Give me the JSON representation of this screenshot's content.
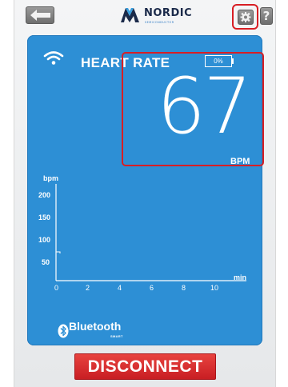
{
  "header": {
    "back_icon": "arrow-left-icon",
    "logo_text": "NORDIC",
    "logo_subtext": "SEMICONDUCTOR",
    "settings_icon": "gear-icon",
    "help_label": "?"
  },
  "panel": {
    "title": "HEART RATE",
    "status_icon": "wifi-icon",
    "battery_text": "0%",
    "bpm_value": "67",
    "bpm_unit": "BPM"
  },
  "graph": {
    "y_label": "bpm",
    "x_label": "min",
    "y_ticks": [
      "200",
      "150",
      "100",
      "50"
    ],
    "x_ticks": [
      "0",
      "2",
      "4",
      "6",
      "8",
      "10"
    ]
  },
  "footer": {
    "bluetooth_text": "Bluetooth",
    "bluetooth_sub": "SMART",
    "disconnect_label": "DISCONNECT"
  },
  "colors": {
    "panel": "#2d8fd5",
    "highlight": "#d81e24",
    "disconnect": "#d22a2c"
  }
}
